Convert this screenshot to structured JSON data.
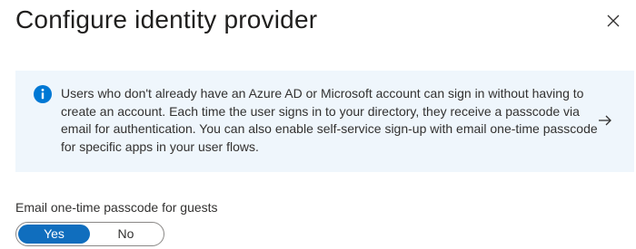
{
  "dialog": {
    "title": "Configure identity provider",
    "close_icon": "close-icon"
  },
  "info_banner": {
    "icon": "info-icon",
    "text": "Users who don't already have an Azure AD or Microsoft account can sign in without having to create an account. Each time the user signs in to your directory, they receive a passcode via email for authentication. You can also enable self-service sign-up with email one-time passcode for specific apps in your user flows.",
    "link_icon": "arrow-right-icon",
    "background_color": "#eff6fc",
    "icon_color": "#0078d4"
  },
  "otp_setting": {
    "label": "Email one-time passcode for guests",
    "options": [
      "Yes",
      "No"
    ],
    "selected": "Yes",
    "selected_color": "#106ebe"
  }
}
